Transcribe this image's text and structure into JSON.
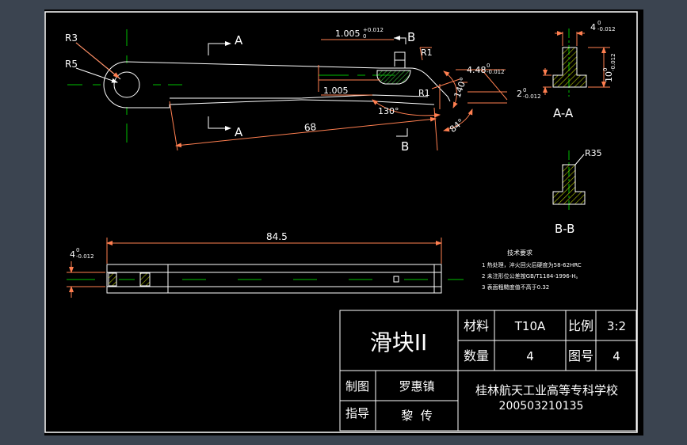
{
  "colors": {
    "canvas_outer": "#3b4450",
    "paper": "#000000",
    "border": "#ffffff",
    "outline": "#ffffff",
    "dimension": "#ff7f50",
    "centerline": "#00c000",
    "hatch": "#b5c800",
    "dim_text": "#ffffff",
    "table_text": "#ffffff"
  },
  "main_view": {
    "label_r3": "R3",
    "label_r5": "R5",
    "section_a_top": "A",
    "section_a_bottom": "A",
    "section_b_top": "B",
    "section_b_bottom": "B",
    "dim_1005_tol": "1.005",
    "dim_1005_tol_sup": "+0.012",
    "dim_1005_tol_sub": "0",
    "dim_1005_plain": "1.005",
    "label_r1_top": "R1",
    "label_r1_mid": "R1",
    "dim_448": "4.48",
    "dim_448_sup": "0",
    "dim_448_sub": "-0.012",
    "dim_140": "140°",
    "dim_130": "130°",
    "dim_84": "84°",
    "dim_2": "2",
    "dim_2_sup": "0",
    "dim_2_sub": "-0.012",
    "dim_68": "68"
  },
  "section_aa": {
    "dim_4": "4",
    "dim_4_sup": "0",
    "dim_4_sub": "-0.012",
    "dim_10": "10",
    "dim_10_sup": "0",
    "dim_10_sub": "-0.012",
    "title": "A-A"
  },
  "section_bb": {
    "label_r35": "R35",
    "title": "B-B"
  },
  "bottom_view": {
    "dim_845": "84.5",
    "dim_4": "4",
    "dim_4_sup": "0",
    "dim_4_sub": "-0.012"
  },
  "tech_requirements": {
    "heading": "技术要求",
    "items": [
      "1 热处理，淬火回火后硬度为58-62HRC",
      "2 未注形位公差按GB/T1184-1996-H。",
      "3 表面粗糙度值不高于0.32"
    ]
  },
  "title_block": {
    "part_name": "滑块II",
    "material_label": "材料",
    "material_value": "T10A",
    "scale_label": "比例",
    "scale_value": "3:2",
    "quantity_label": "数量",
    "quantity_value": "4",
    "drawing_no_label": "图号",
    "drawing_no_value": "4",
    "drawn_by_label": "制图",
    "drawn_by_value": "罗惠镇",
    "guided_by_label": "指导",
    "guided_by_value": "黎  传",
    "school": "桂林航天工业高等专科学校",
    "student_id": "200503210135"
  }
}
